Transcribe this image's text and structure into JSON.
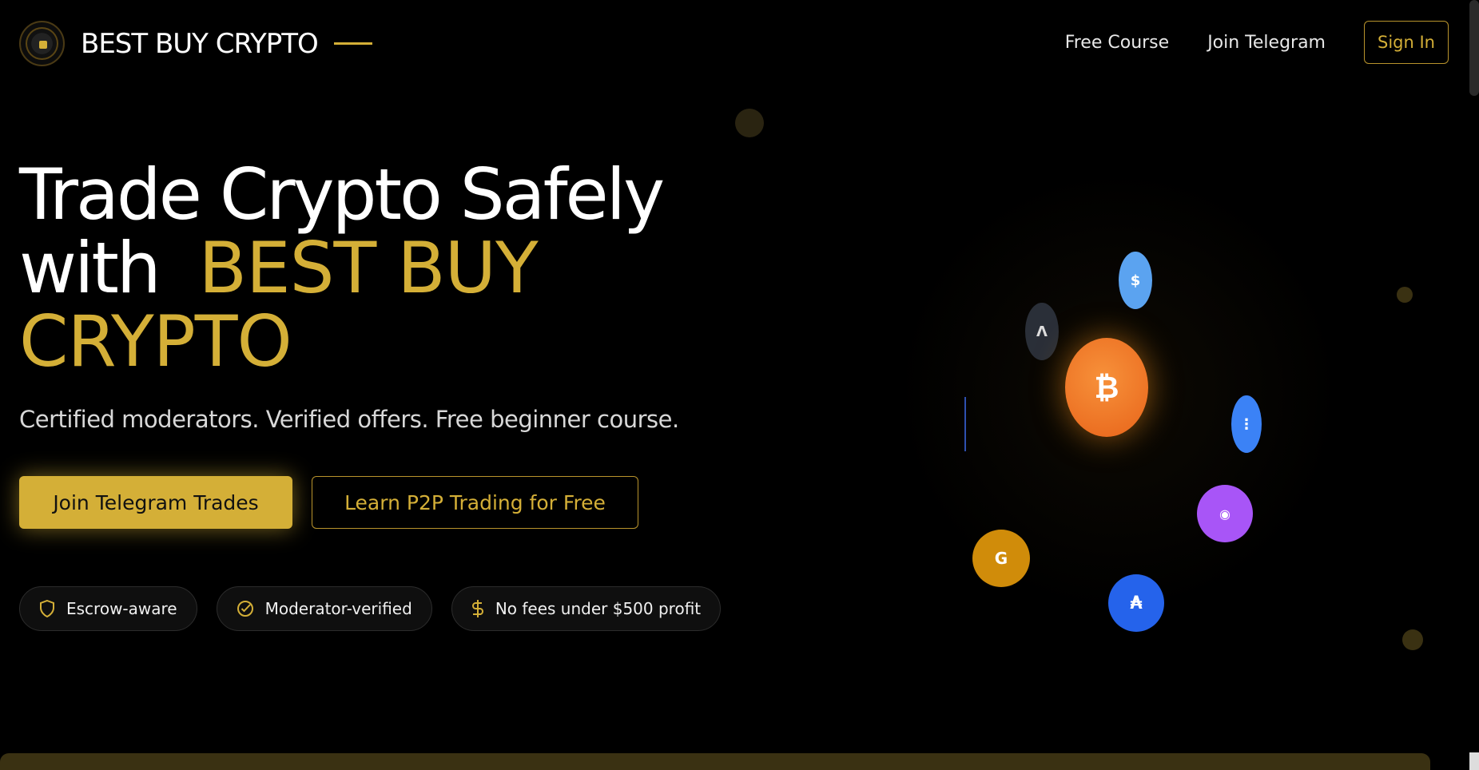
{
  "header": {
    "brand": "BEST  BUY CRYPTO",
    "links": [
      "Free Course",
      "Join Telegram"
    ],
    "signin": "Sign  In"
  },
  "hero": {
    "title_line1": "Trade Crypto Safely",
    "title_with": "with",
    "title_gold1": "BEST  BUY",
    "title_gold2": "CRYPTO",
    "subtitle": "Certified moderators. Verified offers.  Free beginner course.",
    "cta_primary": "Join Telegram Trades",
    "cta_secondary": "Learn  P2P Trading for  Free"
  },
  "badges": [
    {
      "icon": "shield-icon",
      "label": "Escrow-aware"
    },
    {
      "icon": "check-circle-icon",
      "label": "Moderator-verified"
    },
    {
      "icon": "dollar-icon",
      "label": "No fees under $500 profit"
    }
  ],
  "coins": {
    "btc": "₿",
    "usd": "$",
    "a": "Λ",
    "e": "⋮",
    "p": "◉",
    "g": "G",
    "ada": "₳"
  },
  "colors": {
    "accent": "#d4af37",
    "background": "#000000",
    "btc": "#f7931a"
  }
}
